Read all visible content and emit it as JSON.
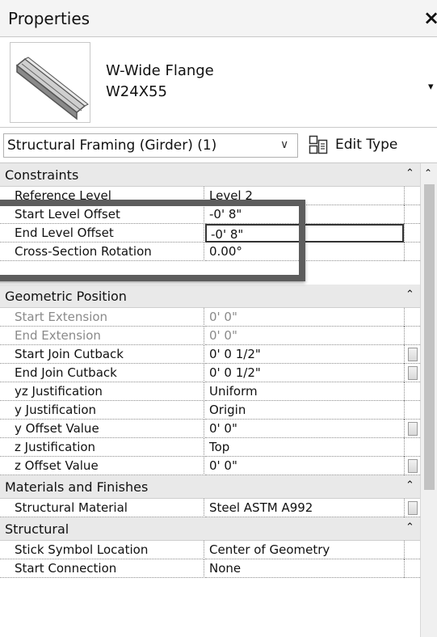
{
  "palette": {
    "title": "Properties",
    "close": "×"
  },
  "type_selector": {
    "family": "W-Wide Flange",
    "type": "W24X55",
    "caret": "▾"
  },
  "filter": {
    "label": "Structural Framing (Girder) (1)",
    "chevron": "∨",
    "edit_type_label": "Edit Type"
  },
  "icons": [
    "i-beam-thumbnail-icon",
    "edit-type-icon",
    "collapse-icon",
    "scroll-up-icon"
  ],
  "groups": {
    "constraints": {
      "title": "Constraints",
      "rows": [
        {
          "name": "Reference Level",
          "value": "Level 2"
        },
        {
          "name": "Start Level Offset",
          "value": "-0'  8\""
        },
        {
          "name": "End Level Offset",
          "value": "-0'  8\""
        },
        {
          "name": "Cross-Section Rotation",
          "value": "0.00°"
        }
      ]
    },
    "geometric": {
      "title": "Geometric Position",
      "rows": [
        {
          "name": "Start Extension",
          "value": "0'  0\""
        },
        {
          "name": "End Extension",
          "value": "0'  0\""
        },
        {
          "name": "Start Join Cutback",
          "value": "0'  0 1/2\""
        },
        {
          "name": "End Join Cutback",
          "value": "0'  0 1/2\""
        },
        {
          "name": "yz Justification",
          "value": "Uniform"
        },
        {
          "name": "y Justification",
          "value": "Origin"
        },
        {
          "name": "y Offset Value",
          "value": "0'  0\""
        },
        {
          "name": "z Justification",
          "value": "Top"
        },
        {
          "name": "z Offset Value",
          "value": "0'  0\""
        }
      ]
    },
    "materials": {
      "title": "Materials and Finishes",
      "rows": [
        {
          "name": "Structural Material",
          "value": "Steel ASTM A992"
        }
      ]
    },
    "structural": {
      "title": "Structural",
      "rows": [
        {
          "name": "Stick Symbol Location",
          "value": "Center of Geometry"
        },
        {
          "name": "Start Connection",
          "value": "None"
        }
      ]
    }
  },
  "collapse_glyph": "⌃",
  "scroll_up_glyph": "⌃"
}
